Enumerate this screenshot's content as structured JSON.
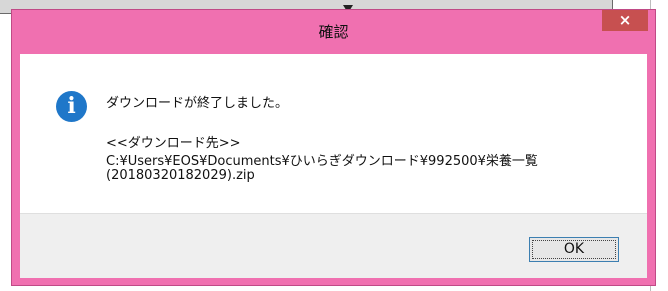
{
  "dialog": {
    "title": "確認",
    "close_label": "×",
    "icon": "info-icon",
    "icon_glyph": "i",
    "message_line1": "ダウンロードが終了しました。",
    "message_line2": "<<ダウンロード先>>",
    "message_line3": "C:¥Users¥EOS¥Documents¥ひいらぎダウンロード¥992500¥栄養一覧",
    "message_line4": "(20180320182029).zip",
    "ok_label": "OK"
  },
  "colors": {
    "frame": "#f070b0",
    "close_button": "#c75050",
    "info_icon": "#1f77c9"
  }
}
